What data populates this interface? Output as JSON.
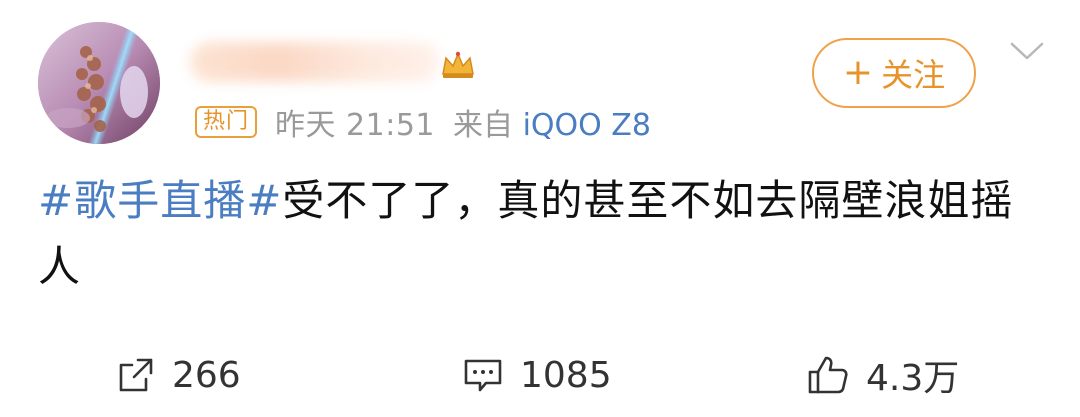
{
  "post": {
    "hot_badge": "热门",
    "time": "昨天 21:51",
    "source_prefix": "来自",
    "source_device": "iQOO Z8",
    "follow_label": "关注",
    "follow_plus": "+",
    "content": {
      "hashtag": "#歌手直播#",
      "text": "受不了了，真的甚至不如去隔壁浪姐摇人"
    }
  },
  "actions": {
    "repost_count": "266",
    "comment_count": "1085",
    "like_count": "4.3万"
  },
  "colors": {
    "accent_orange": "#e8932a",
    "link_blue": "#4a7dc1",
    "meta_gray": "#9a9a9a"
  },
  "icons": {
    "repost": "share-square-icon",
    "comment": "comment-icon",
    "like": "thumbs-up-icon",
    "crown": "crown-icon",
    "chevron": "chevron-down-icon"
  }
}
